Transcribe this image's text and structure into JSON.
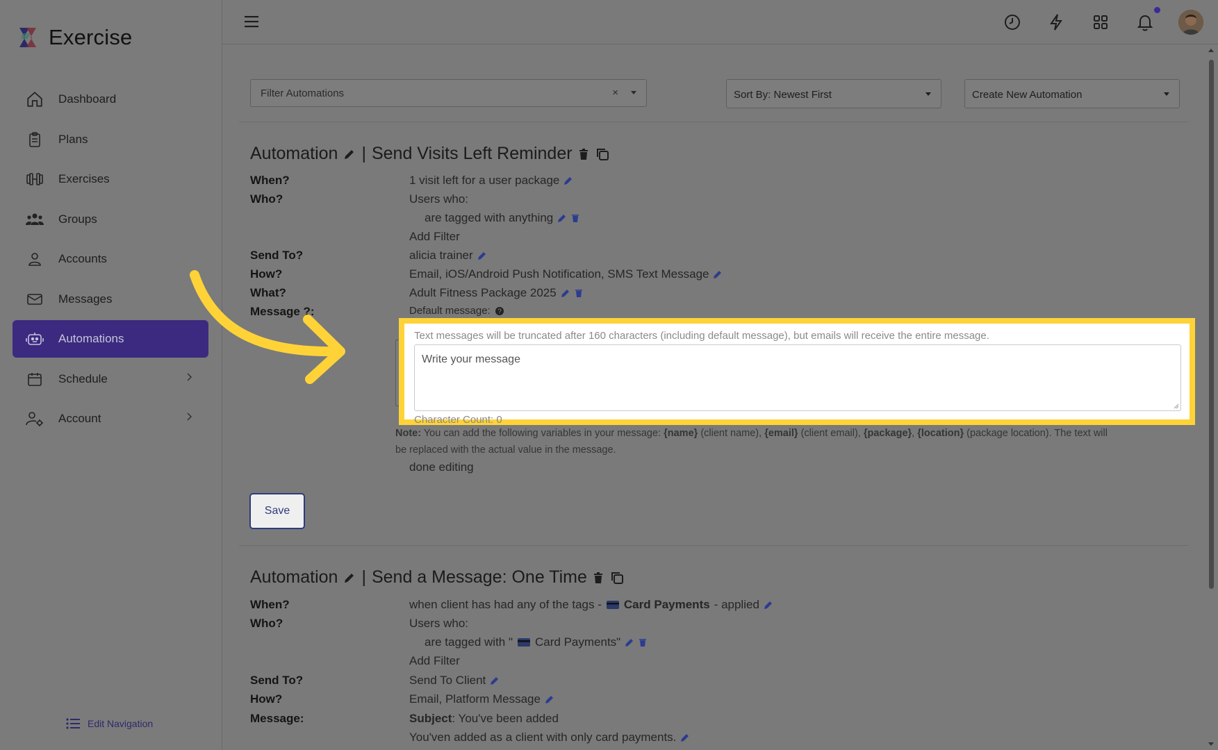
{
  "app": {
    "name": "Exercise"
  },
  "colors": {
    "accent": "#3b2a7f",
    "highlight": "#ffd338",
    "arrow": "#ffd338"
  },
  "sidebar": {
    "items": [
      {
        "label": "Dashboard",
        "icon": "home-icon"
      },
      {
        "label": "Plans",
        "icon": "clipboard-icon"
      },
      {
        "label": "Exercises",
        "icon": "dumbbell-icon"
      },
      {
        "label": "Groups",
        "icon": "users-icon"
      },
      {
        "label": "Accounts",
        "icon": "user-icon"
      },
      {
        "label": "Messages",
        "icon": "mail-icon"
      },
      {
        "label": "Automations",
        "icon": "robot-icon",
        "active": true
      },
      {
        "label": "Schedule",
        "icon": "calendar-icon",
        "has_children": true
      },
      {
        "label": "Account",
        "icon": "user-gear-icon",
        "has_children": true
      }
    ],
    "edit_nav_label": "Edit Navigation"
  },
  "toolbar": {
    "filter_placeholder": "Filter Automations",
    "filter_clear": "×",
    "sort_value": "Sort By: Newest First",
    "create_value": "Create New Automation"
  },
  "automation1": {
    "title_prefix": "Automation",
    "title_sep": "|",
    "title_name": "Send Visits Left Reminder",
    "when_k": "When?",
    "when_v": "1 visit left for a user package",
    "who_k": "Who?",
    "who_v": "Users who:",
    "who_filter": "are tagged with anything",
    "add_filter": "Add Filter",
    "sendto_k": "Send To?",
    "sendto_v": "alicia trainer",
    "how_k": "How?",
    "how_v": "Email, iOS/Android Push Notification, SMS Text Message",
    "what_k": "What?",
    "what_v": "Adult Fitness Package 2025",
    "message_k": "Message ?:",
    "default_message": "Default message:",
    "sms_hint": "Text messages will be truncated after 160 characters (including default message), but emails will receive the entire message.",
    "textarea_placeholder": "Write your message",
    "char_count": "Character Count: 0",
    "note_label": "Note:",
    "note_text_1": "You can add the following variables in your message:",
    "var_name": "{name}",
    "var_name_desc": "(client name),",
    "var_email": "{email}",
    "var_email_desc": "(client email),",
    "var_package": "{package}",
    "var_location": "{location}",
    "var_location_desc": "(package location). The text will",
    "note_text_2": "be replaced with the actual value in the message.",
    "done_editing": "done editing",
    "save_label": "Save"
  },
  "automation2": {
    "title_prefix": "Automation",
    "title_sep": "|",
    "title_name": "Send a Message: One Time",
    "when_k": "When?",
    "when_v_pre": "when client has had any of the tags -",
    "when_tag": "Card Payments",
    "when_v_post": "- applied",
    "who_k": "Who?",
    "who_v": "Users who:",
    "who_filter_pre": "are tagged with \"",
    "who_filter_tag": "Card Payments\"",
    "add_filter": "Add Filter",
    "sendto_k": "Send To?",
    "sendto_v": "Send To Client",
    "how_k": "How?",
    "how_v": "Email, Platform Message",
    "message_k": "Message:",
    "subject_label": "Subject",
    "subject_v": ": You've been added",
    "body": "You'ven added as a client with only card payments."
  }
}
